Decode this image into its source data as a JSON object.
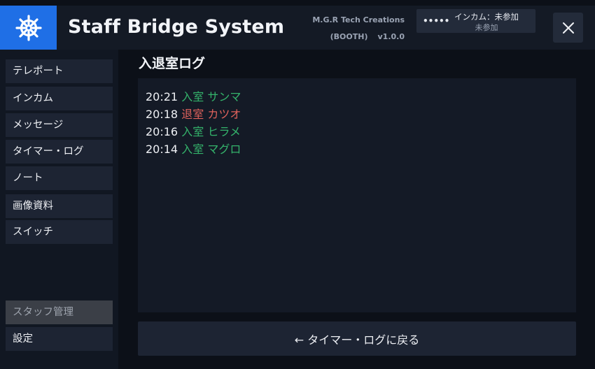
{
  "header": {
    "title": "Staff Bridge System",
    "logo_icon": "ship-wheel-icon",
    "logo_color": "#1f6fe6",
    "credit_line1": "M.G.R Tech Creations",
    "credit_line2": "(BOOTH)",
    "version": "v1.0.0",
    "intercom": {
      "dots": "•••••",
      "status": "インカム：未参加",
      "sub": "未参加"
    },
    "close_icon": "close-icon"
  },
  "sidebar": {
    "items": [
      {
        "label": "テレポート"
      },
      {
        "label": "インカム"
      },
      {
        "label": "メッセージ"
      },
      {
        "label": "タイマー・ログ"
      },
      {
        "label": "ノート"
      },
      {
        "label": "画像資料"
      },
      {
        "label": "スイッチ"
      },
      {
        "label": "スタッフ管理"
      },
      {
        "label": "設定"
      }
    ]
  },
  "main": {
    "title": "入退室ログ",
    "log": [
      {
        "time": "20:21",
        "action": "入室",
        "name": "サンマ",
        "type": "enter"
      },
      {
        "time": "20:18",
        "action": "退室",
        "name": "カツオ",
        "type": "exit"
      },
      {
        "time": "20:16",
        "action": "入室",
        "name": "ヒラメ",
        "type": "enter"
      },
      {
        "time": "20:14",
        "action": "入室",
        "name": "マグロ",
        "type": "enter"
      }
    ],
    "back_button": "← タイマー・ログに戻る"
  },
  "colors": {
    "enter": "#34b36b",
    "exit": "#e0625c"
  }
}
